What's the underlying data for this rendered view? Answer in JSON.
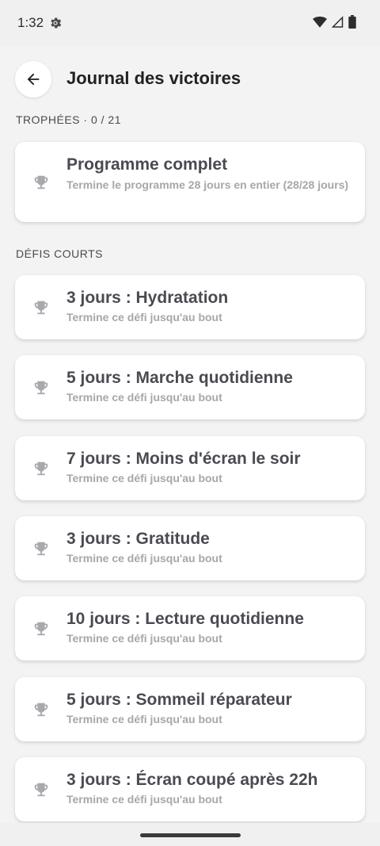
{
  "status": {
    "time": "1:32"
  },
  "header": {
    "title": "Journal des victoires"
  },
  "sections": {
    "trophies_label": "TROPHÉES · 0 / 21",
    "short_label": "DÉFIS COURTS"
  },
  "program_card": {
    "title": "Programme complet",
    "subtitle": "Termine le programme 28 jours en entier (28/28 jours)",
    "icon": "trophy-icon"
  },
  "challenges": [
    {
      "title": "3 jours : Hydratation",
      "subtitle": "Termine ce défi jusqu'au bout"
    },
    {
      "title": "5 jours : Marche quotidienne",
      "subtitle": "Termine ce défi jusqu'au bout"
    },
    {
      "title": "7 jours : Moins d'écran le soir",
      "subtitle": "Termine ce défi jusqu'au bout"
    },
    {
      "title": "3 jours : Gratitude",
      "subtitle": "Termine ce défi jusqu'au bout"
    },
    {
      "title": "10 jours : Lecture quotidienne",
      "subtitle": "Termine ce défi jusqu'au bout"
    },
    {
      "title": "5 jours : Sommeil réparateur",
      "subtitle": "Termine ce défi jusqu'au bout"
    },
    {
      "title": "3 jours : Écran coupé après 22h",
      "subtitle": "Termine ce défi jusqu'au bout"
    }
  ],
  "colors": {
    "background": "#f3f3f3",
    "card": "#ffffff",
    "trophy_locked": "#a8a8ad"
  }
}
